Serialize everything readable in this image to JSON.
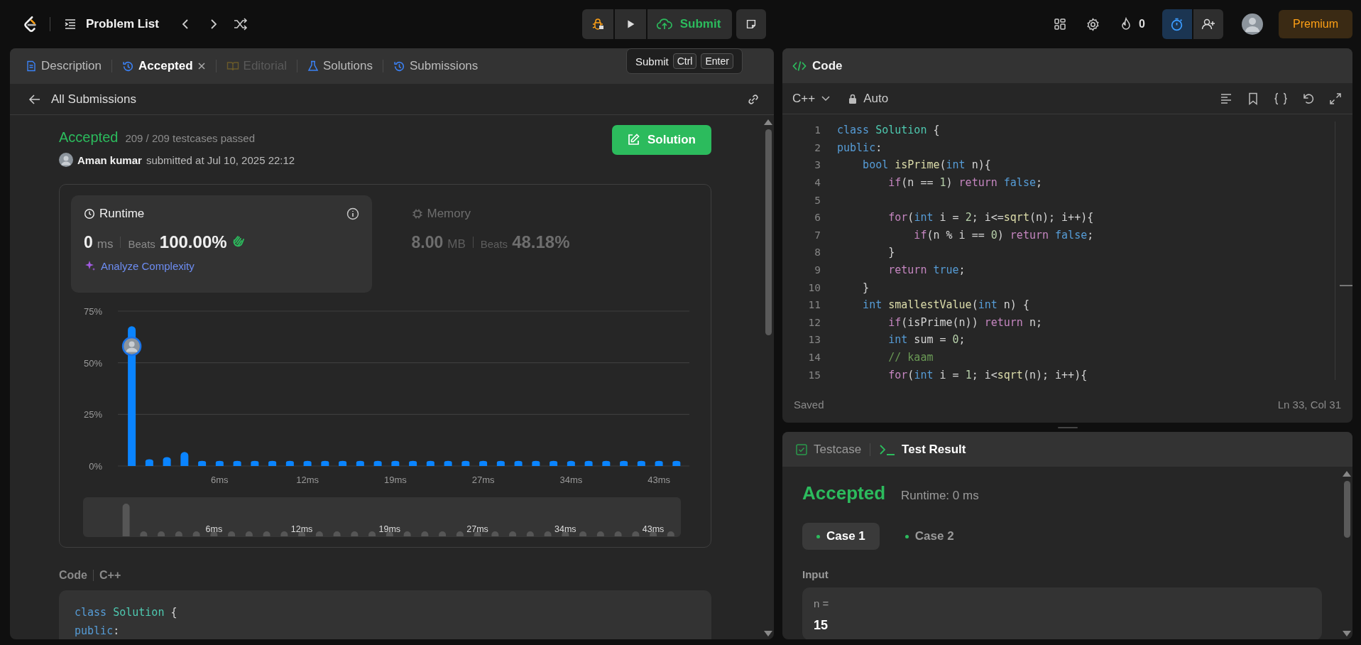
{
  "top_bar": {
    "title": "Problem List",
    "submit": "Submit",
    "streak": "0",
    "premium": "Premium"
  },
  "tooltip": {
    "label": "Submit",
    "keys": [
      "Ctrl",
      "Enter"
    ]
  },
  "left_panel": {
    "tabs": [
      {
        "label": "Description",
        "selected": false,
        "disabled": false,
        "closable": false
      },
      {
        "label": "Accepted",
        "selected": true,
        "disabled": false,
        "closable": true
      },
      {
        "label": "Editorial",
        "selected": false,
        "disabled": true,
        "closable": false
      },
      {
        "label": "Solutions",
        "selected": false,
        "disabled": false,
        "closable": false
      },
      {
        "label": "Submissions",
        "selected": false,
        "disabled": false,
        "closable": false
      }
    ],
    "back_link": "All Submissions",
    "submission": {
      "status": "Accepted",
      "testcases": "209 / 209 testcases passed",
      "author": "Aman kumar",
      "submitted": "submitted at Jul 10, 2025 22:12",
      "solution_button": "Solution"
    },
    "stats": [
      {
        "title": "Runtime",
        "value": "0",
        "unit": "ms",
        "beats_label": "Beats",
        "beats": "100.00%",
        "selected": true,
        "action": "Analyze Complexity"
      },
      {
        "title": "Memory",
        "value": "8.00",
        "unit": "MB",
        "beats_label": "Beats",
        "beats": "48.18%",
        "selected": false
      }
    ],
    "chart_data": {
      "type": "bar",
      "categories": [
        null,
        null,
        null,
        null,
        null,
        "6ms",
        null,
        null,
        null,
        null,
        "12ms",
        null,
        null,
        null,
        null,
        "19ms",
        null,
        null,
        null,
        null,
        "27ms",
        null,
        null,
        null,
        null,
        "34ms",
        null,
        null,
        null,
        null,
        "43ms",
        null
      ],
      "values": [
        67.7,
        3.3,
        4.3,
        6.8,
        2.5,
        2.5,
        2.5,
        2.5,
        2.5,
        2.5,
        2.5,
        2.5,
        2.5,
        2.5,
        2.5,
        2.5,
        2.5,
        2.5,
        2.5,
        2.5,
        2.5,
        2.5,
        2.5,
        2.5,
        2.5,
        2.5,
        2.5,
        2.5,
        2.5,
        2.5,
        2.5,
        2.5
      ],
      "ylim": [
        0,
        75
      ],
      "yticks": [
        {
          "value": 0,
          "label": "0%"
        },
        {
          "value": 25,
          "label": "25%"
        },
        {
          "value": 50,
          "label": "50%"
        },
        {
          "value": 75,
          "label": "75%"
        }
      ]
    },
    "overview_labels": [
      "6ms",
      "12ms",
      "19ms",
      "27ms",
      "34ms",
      "43ms"
    ],
    "code_label": "Code",
    "code_language": "C++",
    "code_preview": [
      {
        "tokens": [
          {
            "kind": "keyword",
            "text": "class "
          },
          {
            "kind": "type",
            "text": "Solution"
          },
          {
            "kind": "plain",
            "text": " {"
          }
        ]
      },
      {
        "tokens": [
          {
            "kind": "keyword",
            "text": "public"
          },
          {
            "kind": "plain",
            "text": ":"
          }
        ]
      }
    ]
  },
  "editor": {
    "title": "Code",
    "language": "C++",
    "mode": "Auto",
    "status": "Saved",
    "cursor": "Ln 33, Col 31",
    "lines": [
      {
        "number": "1",
        "tokens": [
          {
            "kind": "keyword",
            "text": "class "
          },
          {
            "kind": "type",
            "text": "Solution"
          },
          {
            "kind": "plain",
            "text": " {"
          }
        ]
      },
      {
        "number": "2",
        "tokens": [
          {
            "kind": "keyword",
            "text": "public"
          },
          {
            "kind": "plain",
            "text": ":"
          }
        ]
      },
      {
        "number": "3",
        "tokens": [
          {
            "kind": "keyword",
            "text": "    bool "
          },
          {
            "kind": "function",
            "text": "isPrime"
          },
          {
            "kind": "plain",
            "text": "("
          },
          {
            "kind": "keyword",
            "text": "int"
          },
          {
            "kind": "plain",
            "text": " n){"
          }
        ]
      },
      {
        "number": "4",
        "tokens": [
          {
            "kind": "control",
            "text": "        if"
          },
          {
            "kind": "plain",
            "text": "(n == "
          },
          {
            "kind": "number",
            "text": "1"
          },
          {
            "kind": "plain",
            "text": ") "
          },
          {
            "kind": "control",
            "text": "return "
          },
          {
            "kind": "keyword",
            "text": "false"
          },
          {
            "kind": "plain",
            "text": ";"
          }
        ]
      },
      {
        "number": "5"
      },
      {
        "number": "6",
        "tokens": [
          {
            "kind": "control",
            "text": "        for"
          },
          {
            "kind": "plain",
            "text": "("
          },
          {
            "kind": "keyword",
            "text": "int"
          },
          {
            "kind": "plain",
            "text": " i = "
          },
          {
            "kind": "number",
            "text": "2"
          },
          {
            "kind": "plain",
            "text": "; i<="
          },
          {
            "kind": "function",
            "text": "sqrt"
          },
          {
            "kind": "plain",
            "text": "(n); i++){"
          }
        ]
      },
      {
        "number": "7",
        "tokens": [
          {
            "kind": "control",
            "text": "            if"
          },
          {
            "kind": "plain",
            "text": "(n % i == "
          },
          {
            "kind": "number",
            "text": "0"
          },
          {
            "kind": "plain",
            "text": ") "
          },
          {
            "kind": "control",
            "text": "return "
          },
          {
            "kind": "keyword",
            "text": "false"
          },
          {
            "kind": "plain",
            "text": ";"
          }
        ]
      },
      {
        "number": "8",
        "tokens": [
          {
            "kind": "plain",
            "text": "        }"
          }
        ]
      },
      {
        "number": "9",
        "tokens": [
          {
            "kind": "control",
            "text": "        return "
          },
          {
            "kind": "keyword",
            "text": "true"
          },
          {
            "kind": "plain",
            "text": ";"
          }
        ]
      },
      {
        "number": "10",
        "tokens": [
          {
            "kind": "plain",
            "text": "    }"
          }
        ]
      },
      {
        "number": "11",
        "tokens": [
          {
            "kind": "keyword",
            "text": "    int "
          },
          {
            "kind": "function",
            "text": "smallestValue"
          },
          {
            "kind": "plain",
            "text": "("
          },
          {
            "kind": "keyword",
            "text": "int"
          },
          {
            "kind": "plain",
            "text": " n) {"
          }
        ]
      },
      {
        "number": "12",
        "tokens": [
          {
            "kind": "control",
            "text": "        if"
          },
          {
            "kind": "plain",
            "text": "(isPrime(n)) "
          },
          {
            "kind": "control",
            "text": "return"
          },
          {
            "kind": "plain",
            "text": " n;"
          }
        ]
      },
      {
        "number": "13",
        "tokens": [
          {
            "kind": "keyword",
            "text": "        int"
          },
          {
            "kind": "plain",
            "text": " sum = "
          },
          {
            "kind": "number",
            "text": "0"
          },
          {
            "kind": "plain",
            "text": ";"
          }
        ]
      },
      {
        "number": "14",
        "tokens": [
          {
            "kind": "comment",
            "text": "        // kaam"
          }
        ]
      },
      {
        "number": "15",
        "tokens": [
          {
            "kind": "control",
            "text": "        for"
          },
          {
            "kind": "plain",
            "text": "("
          },
          {
            "kind": "keyword",
            "text": "int"
          },
          {
            "kind": "plain",
            "text": " i = "
          },
          {
            "kind": "number",
            "text": "1"
          },
          {
            "kind": "plain",
            "text": "; i<"
          },
          {
            "kind": "function",
            "text": "sqrt"
          },
          {
            "kind": "plain",
            "text": "(n); i++){"
          }
        ]
      }
    ]
  },
  "test_panel": {
    "tabs": [
      {
        "label": "Testcase",
        "selected": false
      },
      {
        "label": "Test Result",
        "selected": true
      }
    ],
    "status": "Accepted",
    "runtime": "Runtime: 0 ms",
    "cases": [
      {
        "label": "Case 1",
        "selected": true
      },
      {
        "label": "Case 2",
        "selected": false
      }
    ],
    "input_label": "Input",
    "input_name": "n =",
    "input_value": "15"
  }
}
